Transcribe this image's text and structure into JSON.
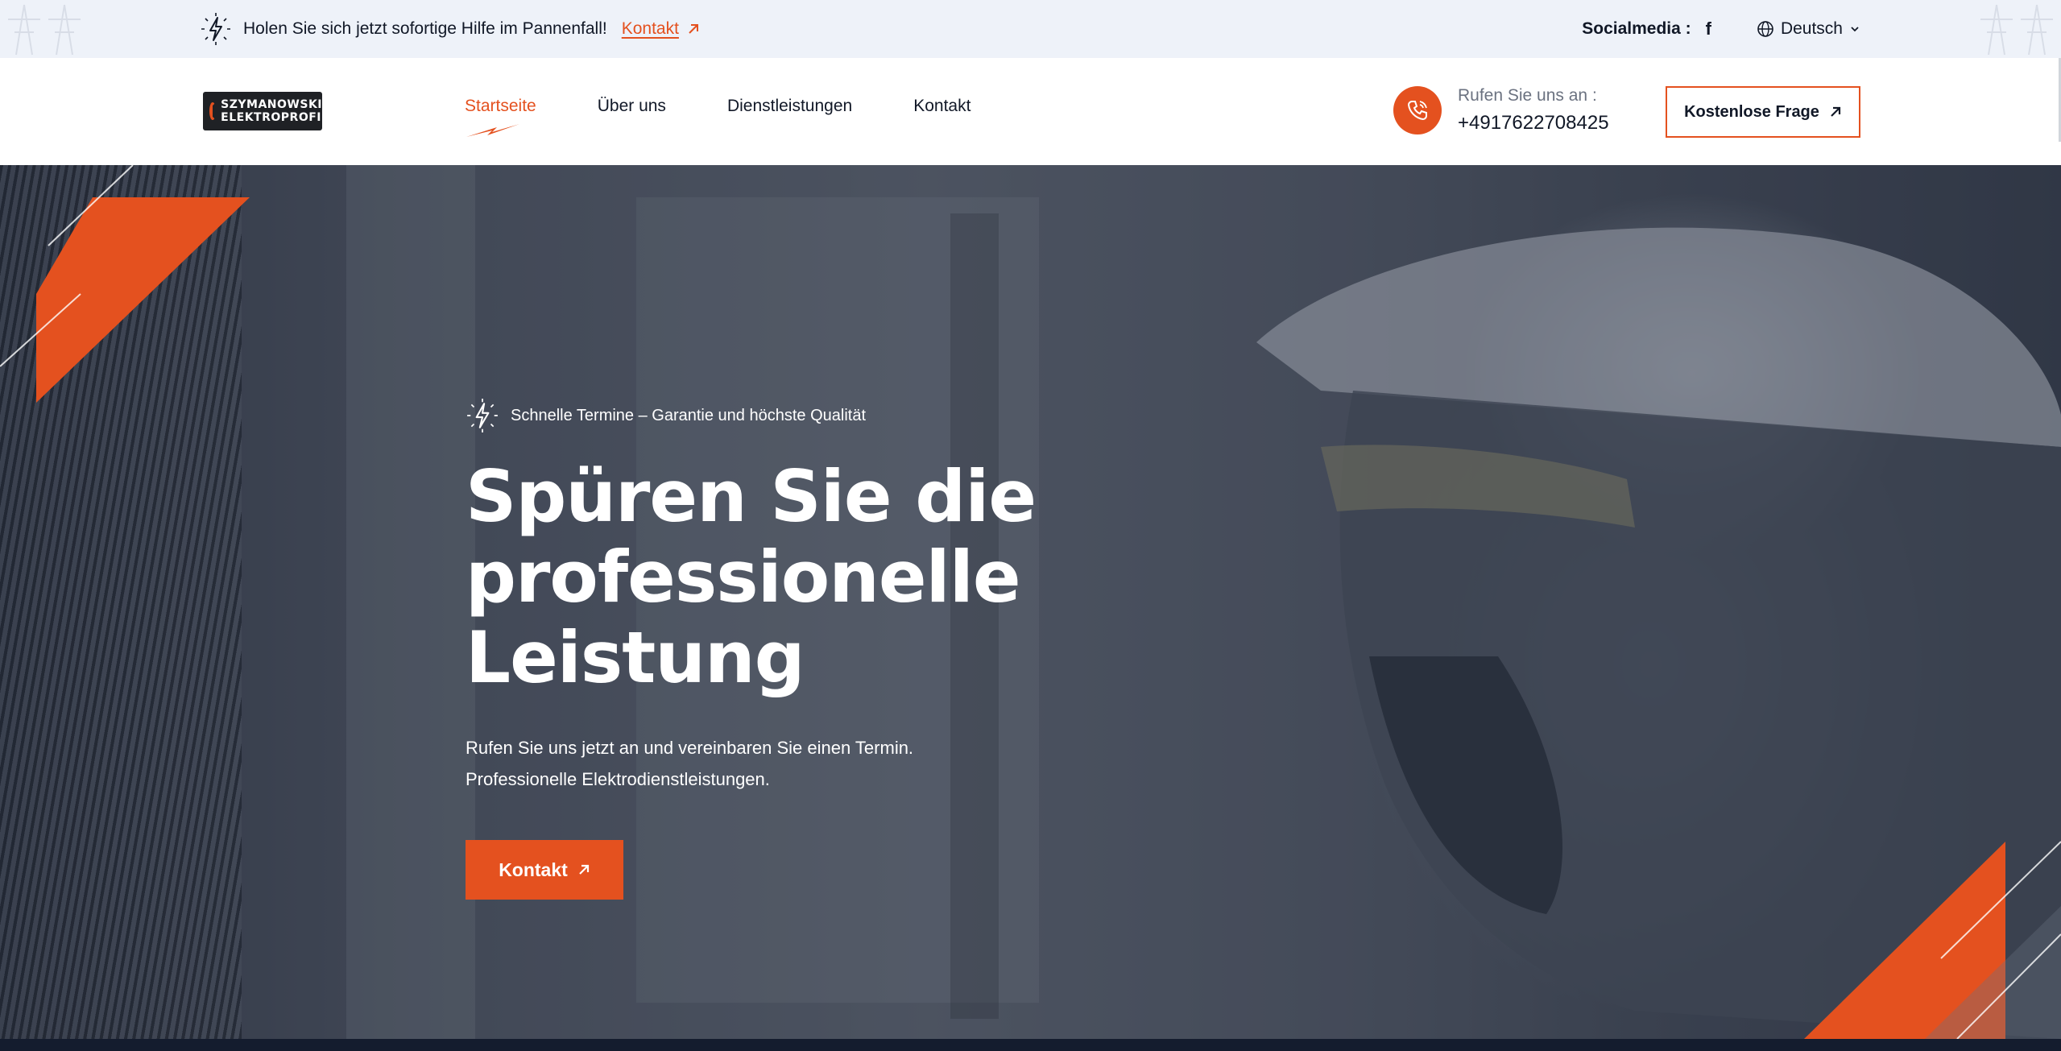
{
  "topbar": {
    "help_text": "Holen Sie sich jetzt sofortige Hilfe im Pannenfall!",
    "help_link": "Kontakt",
    "social_label": "Socialmedia :",
    "social_facebook": "f",
    "language": "Deutsch"
  },
  "header": {
    "logo_line1": "SZYMANOWSKI",
    "logo_line2": "ELEKTROPROFI",
    "nav": [
      "Startseite",
      "Über uns",
      "Dienstleistungen",
      "Kontakt"
    ],
    "phone_label": "Rufen Sie uns an :",
    "phone_number": "+4917622708425",
    "cta_label": "Kostenlose Frage"
  },
  "hero": {
    "badge": "Schnelle Termine – Garantie und höchste Qualität",
    "title_line1": "Spüren Sie die",
    "title_line2": "professionelle Leistung",
    "desc_line1": "Rufen Sie uns jetzt an und vereinbaren Sie einen Termin.",
    "desc_line2": "Professionelle Elektrodienstleistungen.",
    "button_label": "Kontakt"
  },
  "colors": {
    "accent": "#e4511f",
    "topbar_bg": "#eef2f9",
    "dark": "#141c2e"
  },
  "icons": [
    "lightning-icon",
    "arrow-up-right-icon",
    "facebook-icon",
    "globe-icon",
    "chevron-down-icon",
    "phone-icon"
  ]
}
